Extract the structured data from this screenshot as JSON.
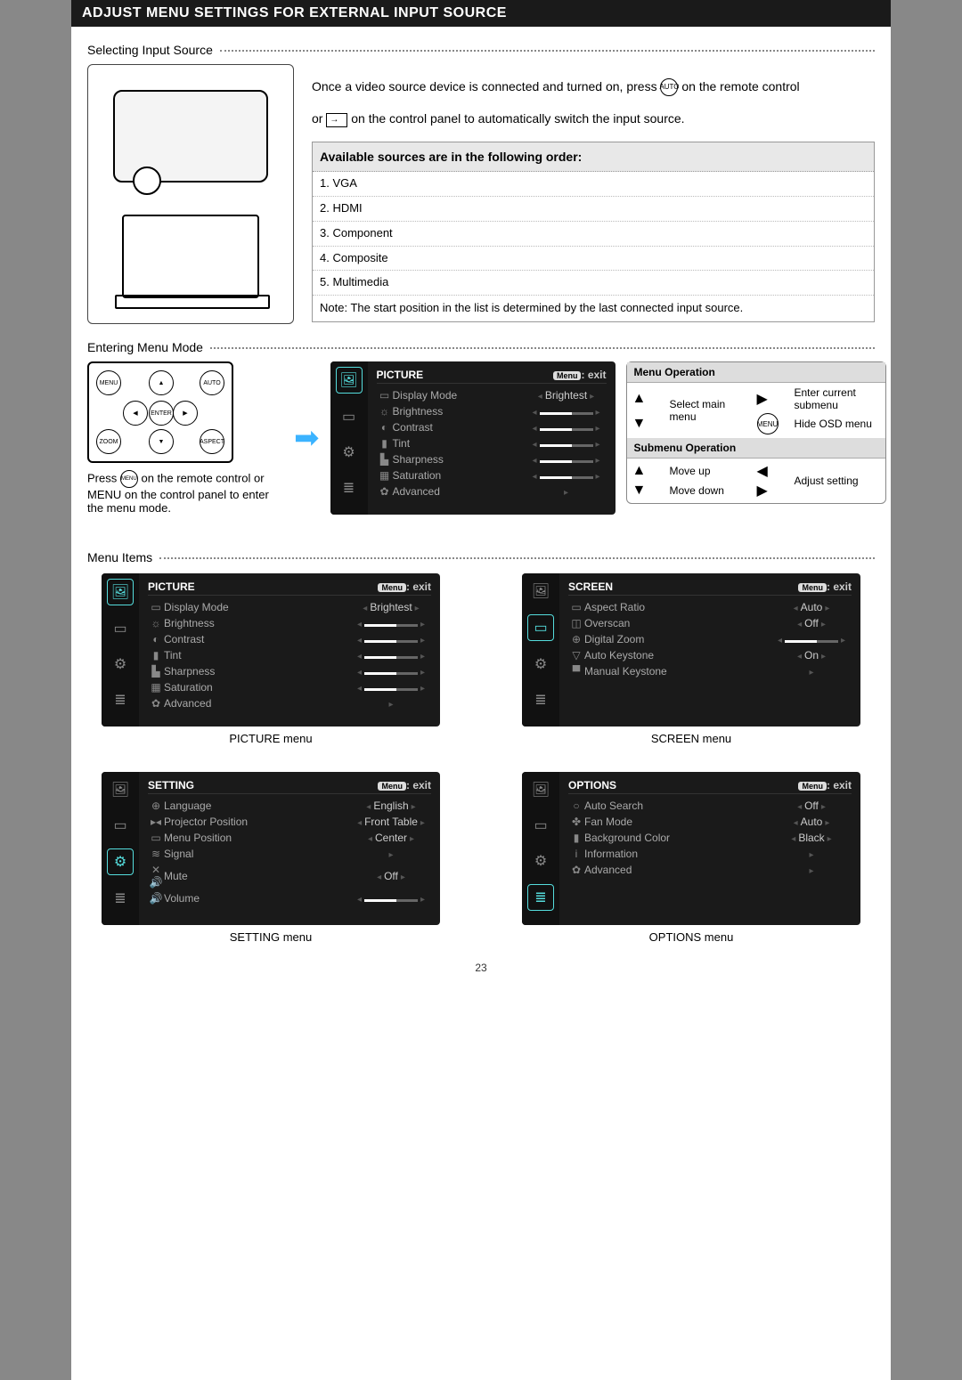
{
  "title": "ADJUST MENU SETTINGS FOR EXTERNAL INPUT SOURCE",
  "sec1": "Selecting Input Source",
  "intro1": "Once a video source device is connected and turned on, press",
  "intro1b": "on the remote control",
  "intro2a": "or",
  "intro2b": "on the control panel to automatically switch the input source.",
  "src_header": "Available sources are in the following order:",
  "sources": [
    "1. VGA",
    "2. HDMI",
    "3. Component",
    "4. Composite",
    "5. Multimedia"
  ],
  "src_note": "Note: The start position in the list is determined by the last connected input source.",
  "sec2": "Entering Menu Mode",
  "remote_btns": {
    "menu": "MENU",
    "auto": "AUTO",
    "enter": "ENTER",
    "zoom": "ZOOM",
    "aspect": "ASPECT"
  },
  "enter_caption_a": "Press",
  "enter_caption_b": "on the remote control",
  "enter_caption_c": "or MENU on the control panel to enter the menu mode.",
  "menu_exit": "Menu",
  "exit_txt": ": exit",
  "picture_title": "PICTURE",
  "picture_items": [
    {
      "ic": "▭",
      "name": "Display Mode",
      "val": "Brightest",
      "type": "text"
    },
    {
      "ic": "☼",
      "name": "Brightness",
      "type": "slider"
    },
    {
      "ic": "◐",
      "name": "Contrast",
      "type": "slider"
    },
    {
      "ic": "▮",
      "name": "Tint",
      "type": "slider"
    },
    {
      "ic": "▙",
      "name": "Sharpness",
      "type": "slider"
    },
    {
      "ic": "▦",
      "name": "Saturation",
      "type": "slider"
    },
    {
      "ic": "✿",
      "name": "Advanced",
      "type": "arrow"
    }
  ],
  "op_title1": "Menu Operation",
  "op_title2": "Submenu Operation",
  "op1": {
    "up": "▲",
    "down": "▼",
    "t1": "Select main menu",
    "right": "▶",
    "menu": "MENU",
    "t2": "Enter current submenu",
    "t3": "Hide OSD menu"
  },
  "op2": {
    "up": "▲",
    "t1": "Move up",
    "down": "▼",
    "t2": "Move down",
    "left": "◀",
    "right": "▶",
    "t3": "Adjust setting"
  },
  "sec3": "Menu Items",
  "screen_title": "SCREEN",
  "screen_items": [
    {
      "ic": "▭",
      "name": "Aspect Ratio",
      "val": "Auto",
      "type": "text"
    },
    {
      "ic": "◫",
      "name": "Overscan",
      "val": "Off",
      "type": "text"
    },
    {
      "ic": "⊕",
      "name": "Digital Zoom",
      "type": "slider"
    },
    {
      "ic": "▽",
      "name": "Auto Keystone",
      "val": "On",
      "type": "text"
    },
    {
      "ic": "▀",
      "name": "Manual Keystone",
      "type": "arrow"
    }
  ],
  "setting_title": "SETTING",
  "setting_items": [
    {
      "ic": "⊕",
      "name": "Language",
      "val": "English",
      "type": "text"
    },
    {
      "ic": "▸◂",
      "name": "Projector Position",
      "val": "Front Table",
      "type": "text"
    },
    {
      "ic": "▭",
      "name": "Menu Position",
      "val": "Center",
      "type": "text"
    },
    {
      "ic": "≋",
      "name": "Signal",
      "type": "arrow"
    },
    {
      "ic": "✕🔊",
      "name": "Mute",
      "val": "Off",
      "type": "text"
    },
    {
      "ic": "🔊",
      "name": "Volume",
      "type": "slider"
    }
  ],
  "options_title": "OPTIONS",
  "options_items": [
    {
      "ic": "○",
      "name": "Auto Search",
      "val": "Off",
      "type": "text"
    },
    {
      "ic": "✤",
      "name": "Fan Mode",
      "val": "Auto",
      "type": "text"
    },
    {
      "ic": "▮",
      "name": "Background Color",
      "val": "Black",
      "type": "text"
    },
    {
      "ic": "i",
      "name": "Information",
      "type": "arrow"
    },
    {
      "ic": "✿",
      "name": "Advanced",
      "type": "arrow"
    }
  ],
  "cap_picture": "PICTURE menu",
  "cap_screen": "SCREEN menu",
  "cap_setting": "SETTING menu",
  "cap_options": "OPTIONS menu",
  "page_num": "23"
}
